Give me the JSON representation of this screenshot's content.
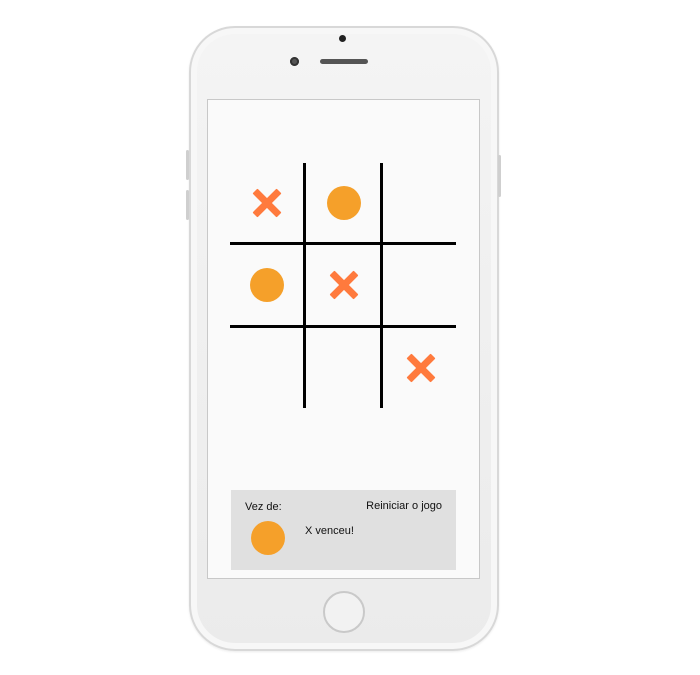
{
  "board": {
    "cells": [
      {
        "mark": "x"
      },
      {
        "mark": "o"
      },
      {
        "mark": ""
      },
      {
        "mark": "o"
      },
      {
        "mark": "x"
      },
      {
        "mark": ""
      },
      {
        "mark": ""
      },
      {
        "mark": ""
      },
      {
        "mark": "x"
      }
    ],
    "x_color": "#ff7a3d",
    "o_color": "#f5a02a"
  },
  "panel": {
    "turn_label": "Vez de:",
    "restart_label": "Reiniciar o jogo",
    "status_text": "X venceu!",
    "current_turn_mark": "o",
    "background": "#e0e0e0"
  }
}
